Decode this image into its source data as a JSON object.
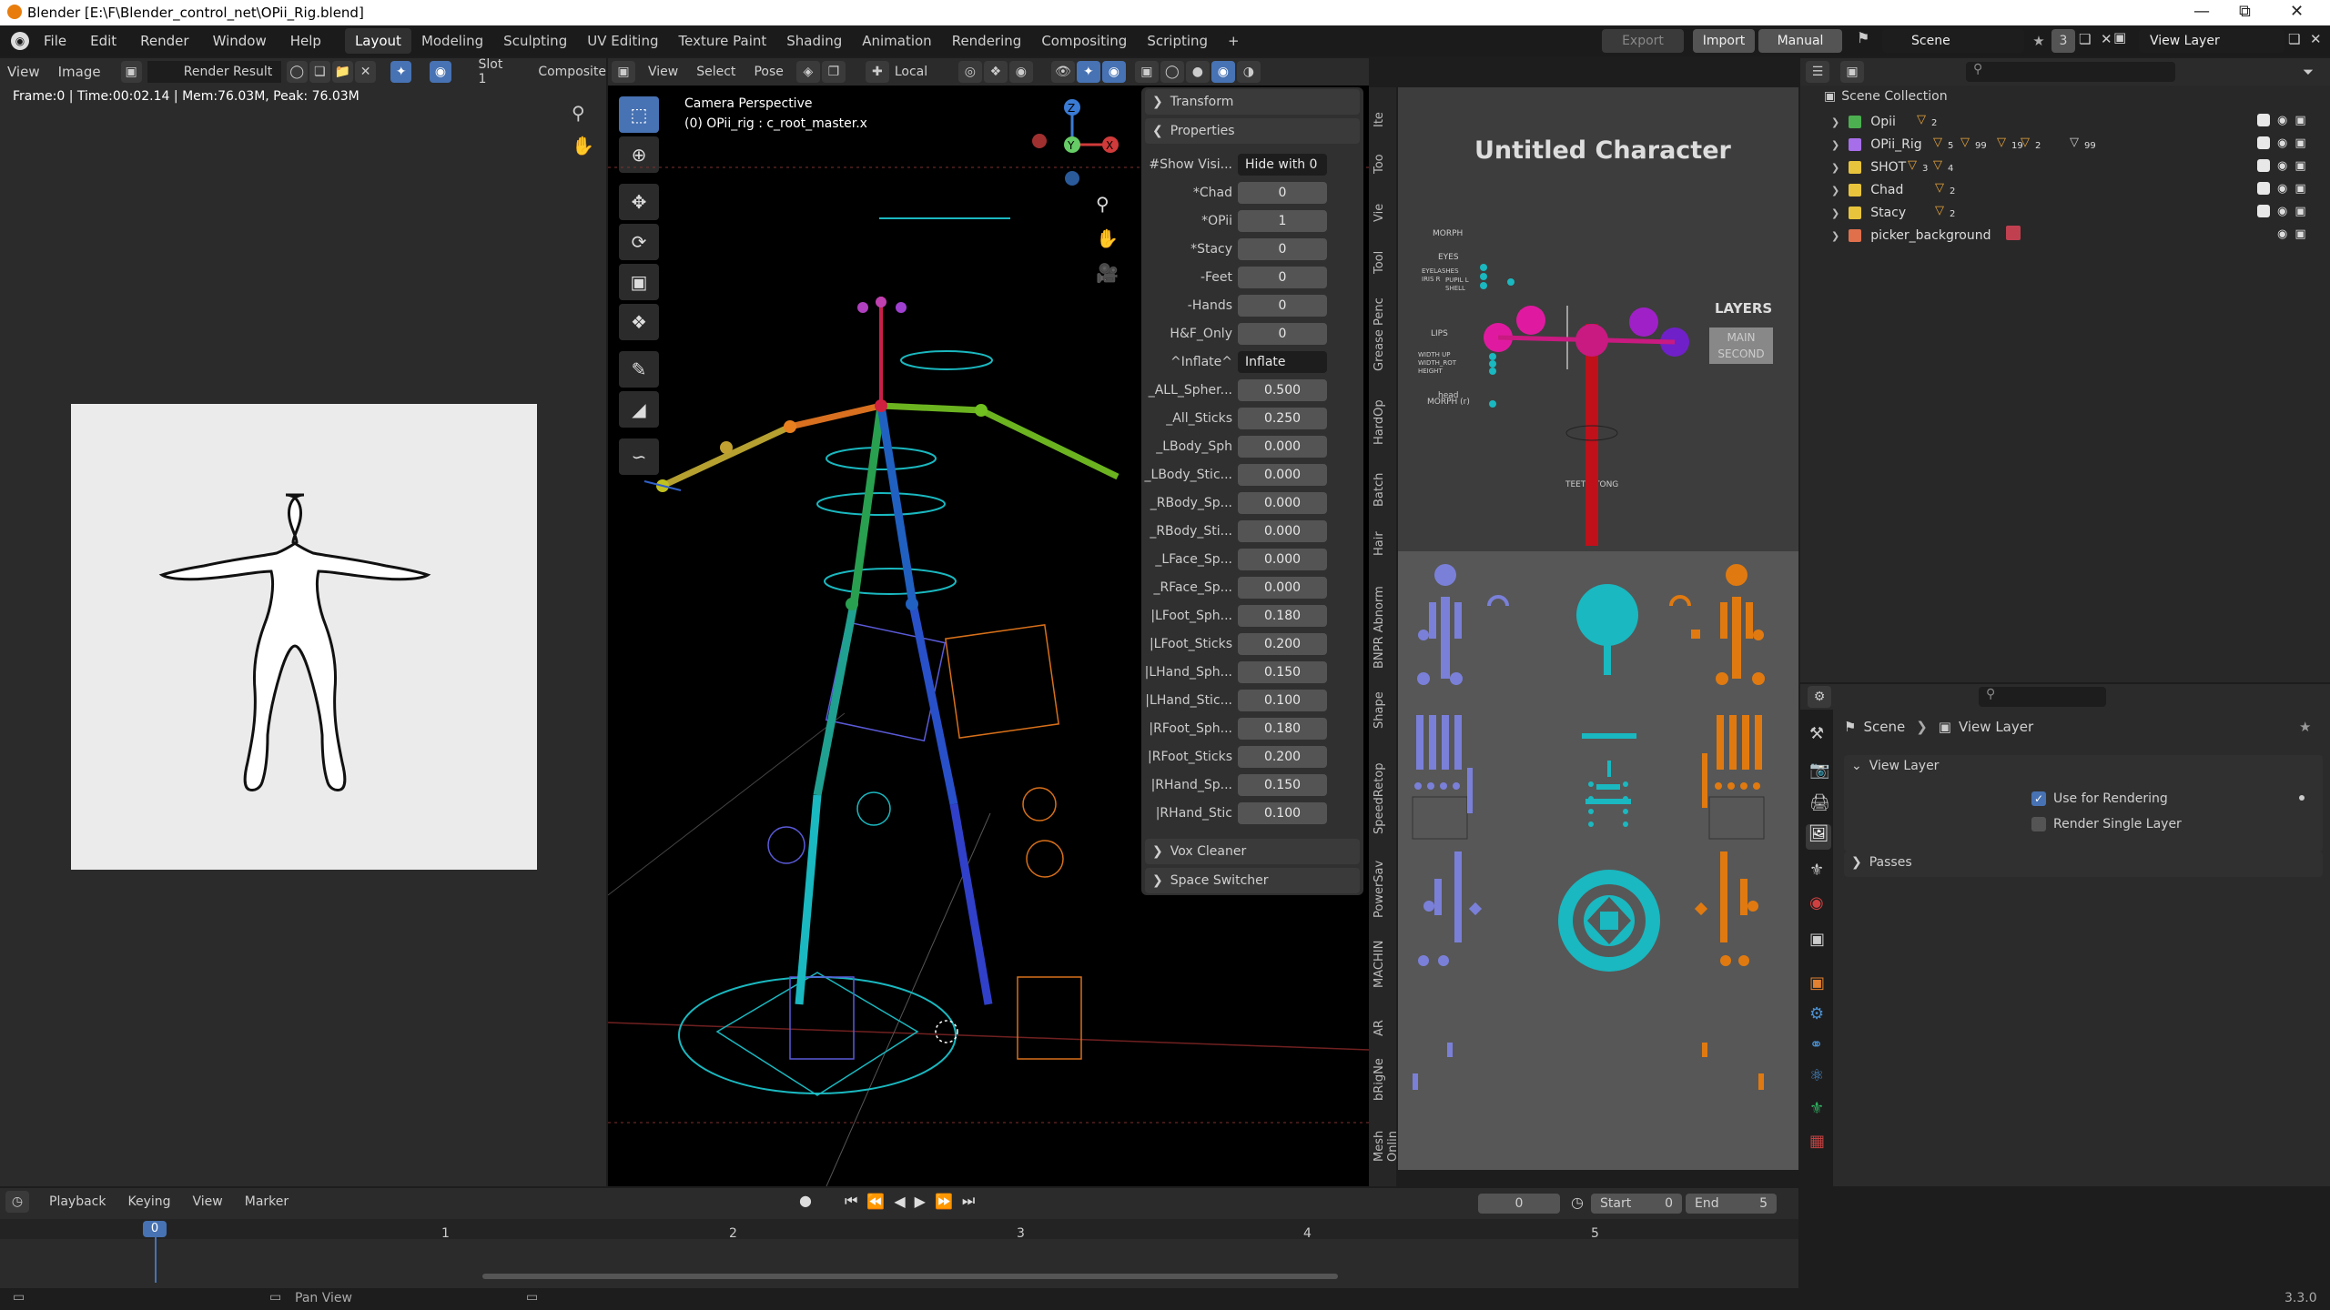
{
  "titlebar": {
    "title": "Blender [E:\\F\\Blender_control_net\\OPii_Rig.blend]"
  },
  "menubar": {
    "menus": [
      "File",
      "Edit",
      "Render",
      "Window",
      "Help"
    ],
    "workspaces": [
      "Layout",
      "Modeling",
      "Sculpting",
      "UV Editing",
      "Texture Paint",
      "Shading",
      "Animation",
      "Rendering",
      "Compositing",
      "Scripting"
    ],
    "add": "+",
    "export": "Export",
    "import": "Import",
    "manual": "Manual",
    "scene": "Scene",
    "scene_count": "3",
    "view_layer": "View Layer"
  },
  "image_editor": {
    "view": "View",
    "image": "Image",
    "render_result": "Render Result",
    "slot": "Slot 1",
    "composite": "Composite",
    "info": "Frame:0 | Time:00:02.14 | Mem:76.03M, Peak: 76.03M"
  },
  "viewport": {
    "menus": [
      "View",
      "Select",
      "Pose"
    ],
    "orientation": "Local",
    "overlay_title": "Camera Perspective",
    "overlay_subtitle": "(0) OPii_rig : c_root_master.x"
  },
  "n_panel": {
    "transform": "Transform",
    "properties": "Properties",
    "rows": [
      {
        "label": "#Show Visi...",
        "value": "Hide with 0",
        "kind": "text"
      },
      {
        "label": "*Chad",
        "value": "0",
        "kind": "num"
      },
      {
        "label": "*OPii",
        "value": "1",
        "kind": "num"
      },
      {
        "label": "*Stacy",
        "value": "0",
        "kind": "num"
      },
      {
        "label": "-Feet",
        "value": "0",
        "kind": "num"
      },
      {
        "label": "-Hands",
        "value": "0",
        "kind": "num"
      },
      {
        "label": "H&F_Only",
        "value": "0",
        "kind": "num"
      },
      {
        "label": "^Inflate^",
        "value": "Inflate",
        "kind": "text"
      },
      {
        "label": "_ALL_Spher...",
        "value": "0.500",
        "kind": "num"
      },
      {
        "label": "_All_Sticks",
        "value": "0.250",
        "kind": "num"
      },
      {
        "label": "_LBody_Sph",
        "value": "0.000",
        "kind": "num"
      },
      {
        "label": "_LBody_Stic...",
        "value": "0.000",
        "kind": "num"
      },
      {
        "label": "_RBody_Sp...",
        "value": "0.000",
        "kind": "num"
      },
      {
        "label": "_RBody_Sti...",
        "value": "0.000",
        "kind": "num"
      },
      {
        "label": "_LFace_Sp...",
        "value": "0.000",
        "kind": "num"
      },
      {
        "label": "_RFace_Sp...",
        "value": "0.000",
        "kind": "num"
      },
      {
        "label": "|LFoot_Sph...",
        "value": "0.180",
        "kind": "num"
      },
      {
        "label": "|LFoot_Sticks",
        "value": "0.200",
        "kind": "num"
      },
      {
        "label": "|LHand_Sph...",
        "value": "0.150",
        "kind": "num"
      },
      {
        "label": "|LHand_Stic...",
        "value": "0.100",
        "kind": "num"
      },
      {
        "label": "|RFoot_Sph...",
        "value": "0.180",
        "kind": "num"
      },
      {
        "label": "|RFoot_Sticks",
        "value": "0.200",
        "kind": "num"
      },
      {
        "label": "|RHand_Sp...",
        "value": "0.150",
        "kind": "num"
      },
      {
        "label": "|RHand_Stic",
        "value": "0.100",
        "kind": "num"
      }
    ],
    "vox_cleaner": "Vox Cleaner",
    "space_switcher": "Space Switcher",
    "tabs": [
      "Ite",
      "Too",
      "Vie",
      "Tool",
      "Grease Penc",
      "HardOp",
      "Batch",
      "Hair",
      "BNPR Abnorm",
      "Shape",
      "SpeedRetop",
      "PowerSav",
      "MACHIN",
      "AR",
      "bRigNe",
      "Mesh Onlin"
    ]
  },
  "picker": {
    "title": "Untitled Character",
    "layers": "LAYERS",
    "layer_main": "MAIN",
    "layer_second": "SECOND",
    "morph": "MORPH",
    "eyes": "EYES",
    "lips": "LIPS",
    "teeth": "TEETH  TONG",
    "head": "head",
    "morph_bottom": "MORPH (r)",
    "eye_small": [
      "EYELASHES",
      "PUPIL L",
      "SHELL",
      "IRIS R",
      "PUPIL R",
      "SHELL"
    ],
    "lip_small": [
      "WIDTH UP",
      "WIDTH_ROT",
      "HEIGHT"
    ]
  },
  "outliner": {
    "root": "Scene Collection",
    "items": [
      {
        "name": "Opii",
        "color": "#4caf50"
      },
      {
        "name": "OPii_Rig",
        "color": "#a66ee8"
      },
      {
        "name": "SHOT",
        "color": "#e8c43c"
      },
      {
        "name": "Chad",
        "color": "#e8c43c"
      },
      {
        "name": "Stacy",
        "color": "#e8c43c"
      },
      {
        "name": "picker_background",
        "color": "#e0704c"
      }
    ],
    "rig_counts": [
      "5",
      "99",
      "19",
      "2",
      "99"
    ],
    "shot_counts": [
      "3",
      "4"
    ],
    "opii_count": "2",
    "chad_count": "2",
    "stacy_count": "2"
  },
  "properties": {
    "breadcrumb_scene": "Scene",
    "breadcrumb_layer": "View Layer",
    "section": "View Layer",
    "use_for_rendering": "Use for Rendering",
    "render_single_layer": "Render Single Layer",
    "passes": "Passes"
  },
  "timeline": {
    "menus": [
      "Playback",
      "Keying",
      "View",
      "Marker"
    ],
    "current_frame": "0",
    "start_label": "Start",
    "start": "0",
    "end_label": "End",
    "end": "5",
    "ticks": [
      "0",
      "1",
      "2",
      "3",
      "4",
      "5"
    ]
  },
  "statusbar": {
    "hint": "Pan View",
    "version": "3.3.0"
  }
}
